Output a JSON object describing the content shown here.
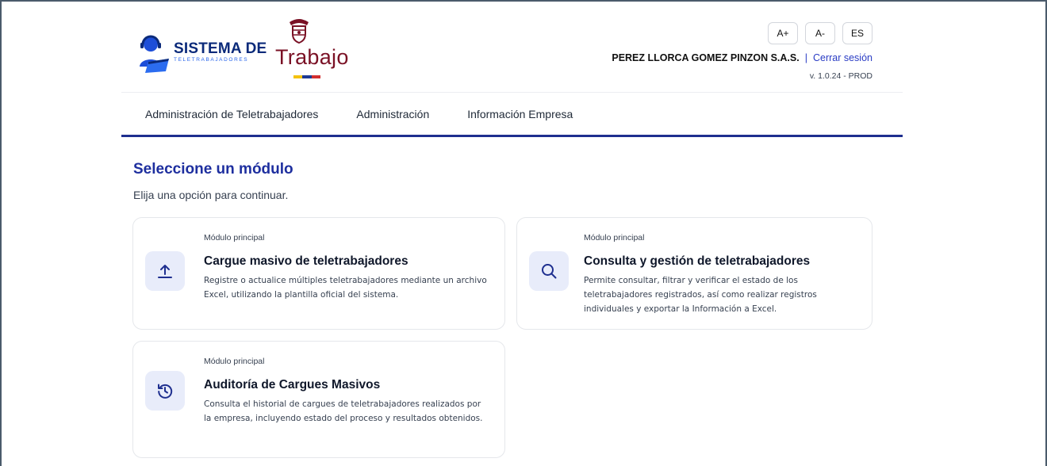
{
  "brand": {
    "title": "SISTEMA DE",
    "subtitle": "TELETRABAJADORES",
    "ministry": "Trabajo",
    "flag_colors": [
      "#f4c20d",
      "#1d3a94",
      "#d32f2f"
    ]
  },
  "header_tools": {
    "increase_font": "A+",
    "decrease_font": "A-",
    "language": "ES"
  },
  "user": {
    "company": "PEREZ LLORCA GOMEZ PINZON S.A.S.",
    "separator": "|",
    "logout_label": "Cerrar sesión",
    "version": "v. 1.0.24 - PROD"
  },
  "nav": {
    "items": [
      {
        "label": "Administración de Teletrabajadores"
      },
      {
        "label": "Administración"
      },
      {
        "label": "Información Empresa"
      }
    ]
  },
  "main": {
    "title": "Seleccione un módulo",
    "subtitle": "Elija una opción para continuar.",
    "cards": [
      {
        "kicker": "Módulo principal",
        "title": "Cargue masivo de teletrabajadores",
        "description": "Registre o actualice múltiples teletrabajadores mediante un archivo Excel, utilizando la plantilla oficial del sistema.",
        "icon": "upload-icon"
      },
      {
        "kicker": "Módulo principal",
        "title": "Consulta y gestión de teletrabajadores",
        "description": "Permite consultar, filtrar y verificar el estado de los teletrabajadores registrados, así como realizar registros individuales y exportar la Información a Excel.",
        "icon": "search-icon"
      },
      {
        "kicker": "Módulo principal",
        "title": "Auditoría de Cargues Masivos",
        "description": "Consulta el historial de cargues de teletrabajadores realizados por la empresa, incluyendo estado del proceso y resultados obtenidos.",
        "icon": "history-icon"
      }
    ]
  },
  "colors": {
    "primary": "#1e2f9f",
    "nav_underline": "#1e2f8f",
    "ministry": "#7a1125",
    "icon_bg": "#e8ecfa"
  }
}
